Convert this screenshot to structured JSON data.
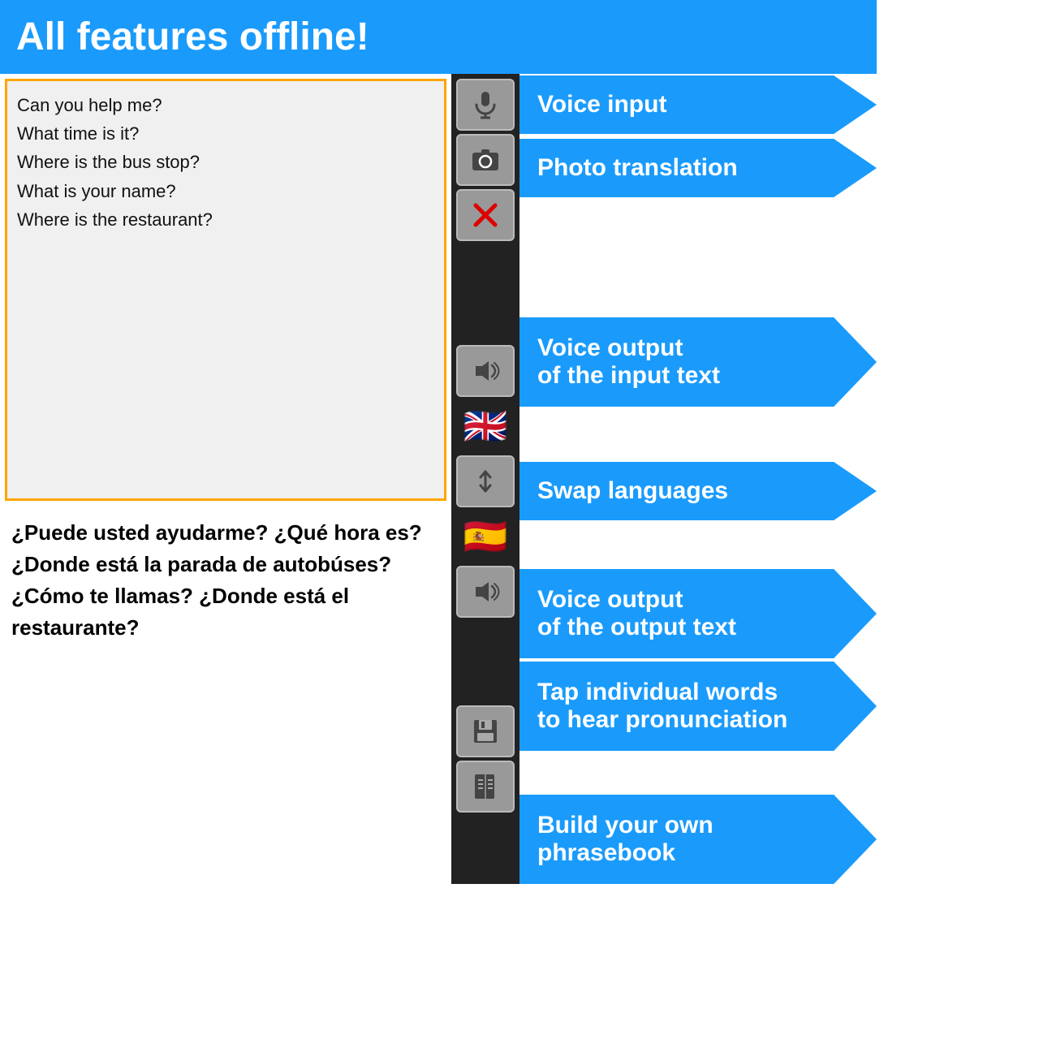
{
  "header": {
    "title": "All features offline!"
  },
  "input": {
    "lines": [
      "Can you help me?",
      "What time is it?",
      "Where is the bus stop?",
      "What is your name?",
      "Where is the restaurant?"
    ]
  },
  "output": {
    "text": "¿Puede usted ayudarme? ¿Qué hora es? ¿Donde está la parada de autobúses? ¿Cómo te llamas? ¿Donde está el restaurante?"
  },
  "callouts": {
    "voice_input": "Voice input",
    "photo_translation": "Photo translation",
    "voice_input_text": "Voice output\nof the input text",
    "swap_languages": "Swap languages",
    "voice_output_text": "Voice output\nof the output text",
    "tap_words": "Tap individual words\nto hear pronunciation",
    "build_phrasebook": "Build your own\nphrasebook"
  },
  "colors": {
    "blue": "#1a9bfc",
    "toolbar_bg": "#222",
    "btn_bg": "#999",
    "orange": "orange"
  }
}
